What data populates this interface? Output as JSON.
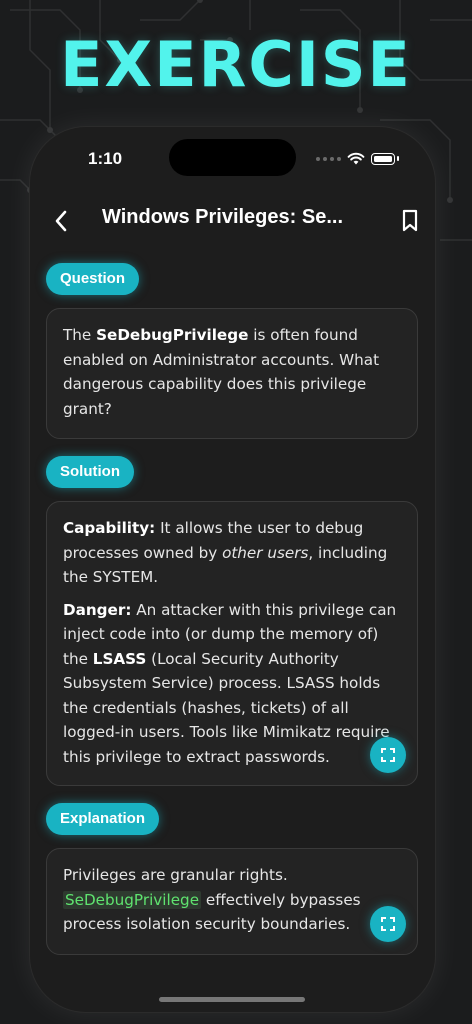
{
  "hero_title": "EXERCISE",
  "status": {
    "time": "1:10"
  },
  "nav": {
    "title": "Windows Privileges: Se..."
  },
  "sections": {
    "question": {
      "tag": "Question",
      "text_1": "The ",
      "bold": "SeDebugPrivilege",
      "text_2": " is often found enabled on Administrator accounts. What dangerous capability does this privilege grant?"
    },
    "solution": {
      "tag": "Solution",
      "capability_label": "Capability:",
      "capability_text_1": " It allows the user to debug processes owned by ",
      "capability_italic": "other users",
      "capability_text_2": ", including the SYSTEM.",
      "danger_label": "Danger:",
      "danger_text_1": " An attacker with this privilege can inject code into (or dump the memory of) the ",
      "danger_bold": "LSASS",
      "danger_text_2": " (Local Security Authority Subsystem Service) process. LSASS holds the credentials (hashes, tickets) of all logged-in users. Tools like Mimikatz require this privilege to extract passwords."
    },
    "explanation": {
      "tag": "Explanation",
      "text_1": "Privileges are granular rights. ",
      "code": "SeDebugPrivilege",
      "text_2": " effectively bypasses process isolation security boundaries."
    }
  },
  "colors": {
    "accent": "#19b3c3",
    "hero": "#52f3ec",
    "code_green": "#5fe36f"
  },
  "icons": [
    "back-chevron-icon",
    "bookmark-icon",
    "expand-icon",
    "wifi-icon",
    "battery-icon",
    "signal-dots-icon"
  ]
}
